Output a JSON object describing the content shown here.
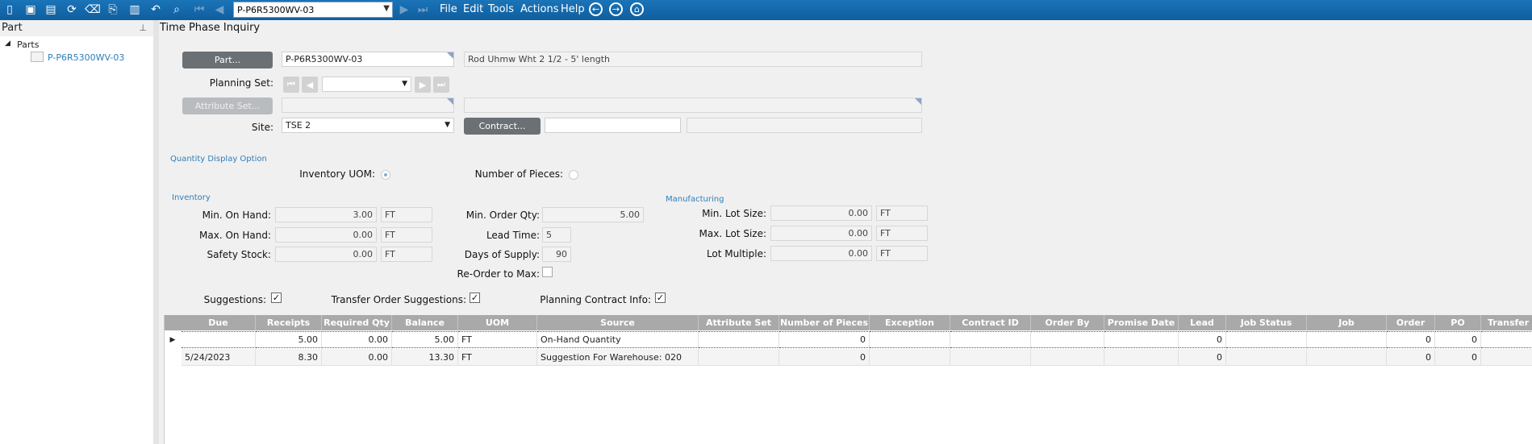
{
  "toolbar": {
    "part_combo_value": "P-P6R5300WV-03",
    "menu": [
      "File",
      "Edit",
      "Tools",
      "Actions",
      "Help"
    ]
  },
  "tree": {
    "header": "Part",
    "root": "Parts",
    "child": "P-P6R5300WV-03"
  },
  "main": {
    "title": "Time Phase Inquiry",
    "part_button": "Part...",
    "part_value": "P-P6R5300WV-03",
    "part_description": "Rod Uhmw Wht 2 1/2  - 5' length",
    "planning_set_label": "Planning Set:",
    "attribute_set_button": "Attribute Set...",
    "site_label": "Site:",
    "site_value": "TSE 2",
    "contract_button": "Contract..."
  },
  "qty_display": {
    "section": "Quantity Display Option",
    "inventory_uom_label": "Inventory UOM:",
    "inventory_uom_selected": true,
    "number_of_pieces_label": "Number of Pieces:",
    "number_of_pieces_selected": false
  },
  "inventory": {
    "section": "Inventory",
    "min_on_hand_label": "Min. On Hand:",
    "min_on_hand": "3.00",
    "min_on_hand_uom": "FT",
    "max_on_hand_label": "Max. On Hand:",
    "max_on_hand": "0.00",
    "max_on_hand_uom": "FT",
    "safety_stock_label": "Safety Stock:",
    "safety_stock": "0.00",
    "safety_stock_uom": "FT",
    "min_order_qty_label": "Min. Order Qty:",
    "min_order_qty": "5.00",
    "lead_time_label": "Lead Time:",
    "lead_time": "5",
    "days_of_supply_label": "Days of Supply:",
    "days_of_supply": "90",
    "reorder_to_max_label": "Re-Order to Max:",
    "reorder_to_max": false
  },
  "manufacturing": {
    "section": "Manufacturing",
    "min_lot_size_label": "Min. Lot Size:",
    "min_lot_size": "0.00",
    "min_lot_size_uom": "FT",
    "max_lot_size_label": "Max. Lot Size:",
    "max_lot_size": "0.00",
    "max_lot_size_uom": "FT",
    "lot_multiple_label": "Lot Multiple:",
    "lot_multiple": "0.00",
    "lot_multiple_uom": "FT"
  },
  "options": {
    "suggestions_label": "Suggestions:",
    "suggestions": true,
    "transfer_order_label": "Transfer Order Suggestions:",
    "transfer_order": true,
    "planning_contract_label": "Planning Contract Info:",
    "planning_contract": true,
    "check_glyph": "✓"
  },
  "grid": {
    "columns": [
      "Due",
      "Receipts",
      "Required Qty",
      "Balance",
      "UOM",
      "Source",
      "Attribute Set",
      "Number of Pieces",
      "Exception",
      "Contract ID",
      "Order By",
      "Promise Date",
      "Lead",
      "Job Status",
      "Job",
      "Order",
      "PO",
      "Transfer O"
    ],
    "rows": [
      [
        "",
        "5.00",
        "0.00",
        "5.00",
        "FT",
        "On-Hand Quantity",
        "",
        "0",
        "",
        "",
        "",
        "",
        "0",
        "",
        "",
        "0",
        "0",
        ""
      ],
      [
        "5/24/2023",
        "8.30",
        "0.00",
        "13.30",
        "FT",
        "Suggestion For Warehouse: 020",
        "",
        "0",
        "",
        "",
        "",
        "",
        "0",
        "",
        "",
        "0",
        "0",
        ""
      ]
    ]
  }
}
